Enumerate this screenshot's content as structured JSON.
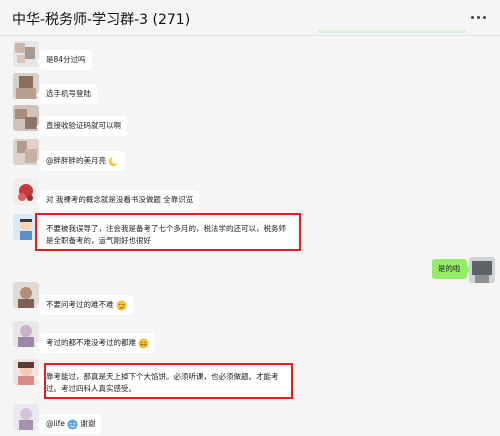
{
  "header": {
    "title": "中华-税务师-学习群-3 (271)"
  },
  "messages": [
    {
      "text": "是84分过吗"
    },
    {
      "text": "选手机号登陆"
    },
    {
      "text": "直接收验证码就可以啊"
    },
    {
      "text": "@胖胖胖的美月亮",
      "emoji": "moon-emoji"
    },
    {
      "text": "对 我裸考的概念就是没看书没做题 全靠识览"
    },
    {
      "text": "不要被我误导了，注会我是备考了七个多月的，税法学的还可以，税务师是全职备考的，运气刚好也很好"
    },
    {
      "text": "是的啦",
      "mine": true
    },
    {
      "text": "不要问考过的难不难",
      "emoji": "smirk-emoji"
    },
    {
      "text": "考过的都不难没考过的都难",
      "emoji": "grin-emoji"
    },
    {
      "text": "靠考能过，那真是天上掉下个大馅饼。必须听课，也必须做题。才能考过。考过四科人真实感受。"
    },
    {
      "text": "@life",
      "emoji": "smile-emoji",
      "suffix": " 谢谢"
    }
  ],
  "colors": {
    "bubble_other": "#ffffff",
    "bubble_mine": "#95ec69",
    "highlight": "#e02020",
    "background": "#f5f5f5"
  }
}
